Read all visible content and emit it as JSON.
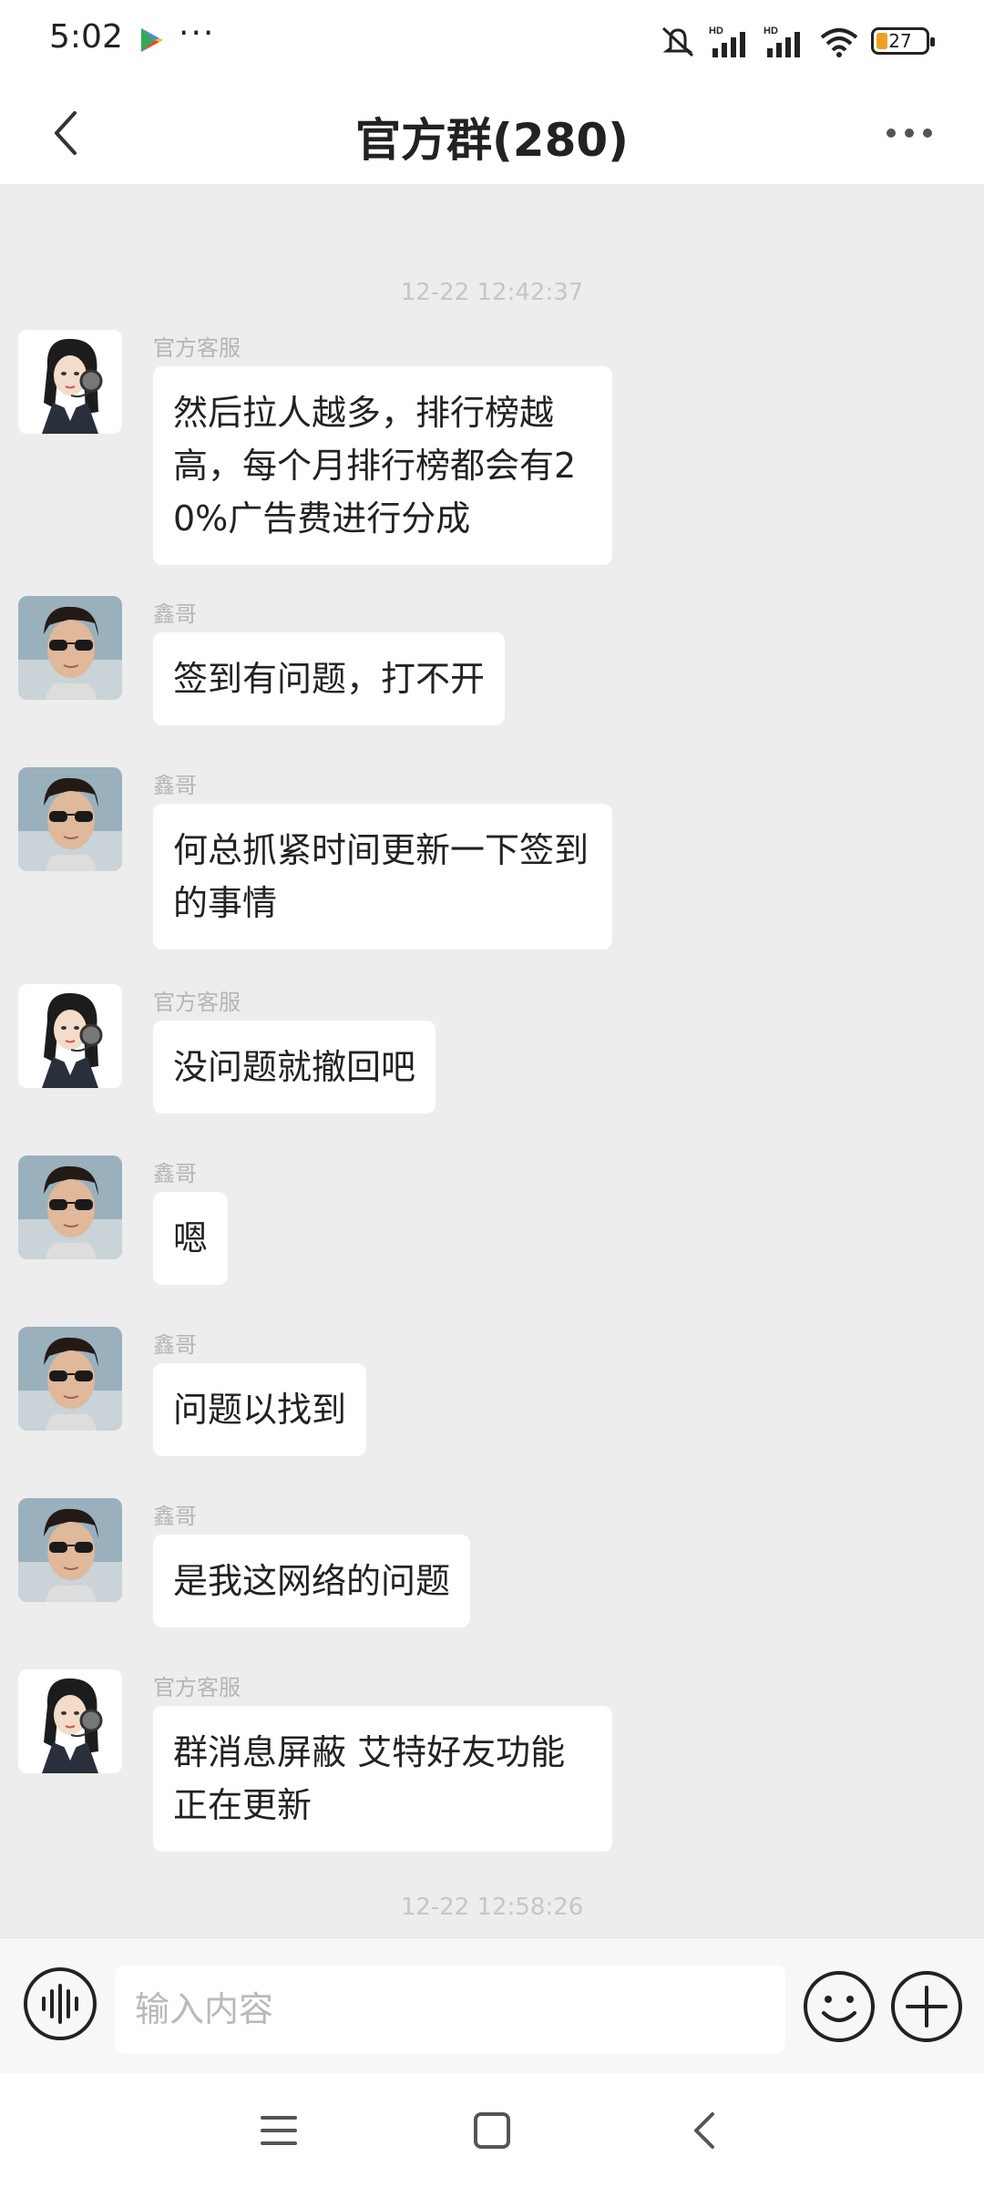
{
  "status_bar": {
    "time": "5:02",
    "dots": "···",
    "battery": "27"
  },
  "header": {
    "title": "官方群(280)"
  },
  "timestamps": [
    "12-22 12:42:37",
    "12-22 12:58:26"
  ],
  "messages": [
    {
      "sender": "官方客服",
      "text": "然后拉人越多，排行榜越高，每个月排行榜都会有20%广告费进行分成"
    },
    {
      "sender": "鑫哥",
      "text": "签到有问题，打不开"
    },
    {
      "sender": "鑫哥",
      "text": "何总抓紧时间更新一下签到的事情"
    },
    {
      "sender": "官方客服",
      "text": "没问题就撤回吧"
    },
    {
      "sender": "鑫哥",
      "text": "嗯"
    },
    {
      "sender": "鑫哥",
      "text": "问题以找到"
    },
    {
      "sender": "鑫哥",
      "text": "是我这网络的问题"
    },
    {
      "sender": "官方客服",
      "text": "群消息屏蔽  艾特好友功能正在更新"
    }
  ],
  "input": {
    "placeholder": "输入内容"
  },
  "icons": {
    "back": "chevron-left-icon",
    "more": "more-horizontal-icon",
    "voice": "voice-wave-icon",
    "emoji": "emoji-icon",
    "plus": "plus-circle-icon",
    "nav_menu": "menu-icon",
    "nav_home": "square-icon",
    "nav_back": "back-triangle-icon"
  }
}
